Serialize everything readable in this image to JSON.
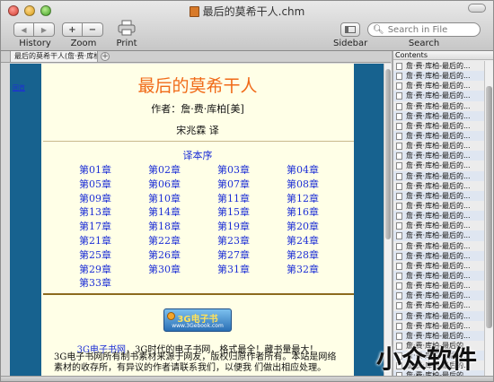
{
  "window": {
    "title": "最后的莫希干人.chm"
  },
  "toolbar": {
    "history_label": "History",
    "zoom_label": "Zoom",
    "print_label": "Print",
    "sidebar_label": "Sidebar",
    "search_label": "Search",
    "back_glyph": "◀",
    "forward_glyph": "▶",
    "zoom_in_glyph": "+",
    "zoom_out_glyph": "−",
    "search_placeholder": "Search in File",
    "search_icon_glyph": "🔍︎"
  },
  "tabs": [
    {
      "label": "最后的莫希干人(詹·费·库柏)"
    }
  ],
  "tab_add_glyph": "+",
  "page": {
    "left_nav_link": "回首",
    "title": "最后的莫希干人",
    "author": "作者：詹·费·库柏[美]",
    "translator": "宋兆霖  译",
    "preface": "译本序",
    "chapters": [
      "第01章",
      "第02章",
      "第03章",
      "第04章",
      "第05章",
      "第06章",
      "第07章",
      "第08章",
      "第09章",
      "第10章",
      "第11章",
      "第12章",
      "第13章",
      "第14章",
      "第15章",
      "第16章",
      "第17章",
      "第18章",
      "第19章",
      "第20章",
      "第21章",
      "第22章",
      "第23章",
      "第24章",
      "第25章",
      "第26章",
      "第27章",
      "第28章",
      "第29章",
      "第30章",
      "第31章",
      "第32章",
      "第33章"
    ],
    "logo_main": "3G电子书",
    "logo_sub": "www.3Gebook.com",
    "footer_link": "3G电子书网",
    "footer_line1_rest": "，3G时代的电子书网，格式最全！藏书量最大！",
    "footer_line2": "3G电子书网所有制书素材来源于网友，版权归原作者所有。本站是网络",
    "footer_line3": "素材的收存所，有异议的作者请联系我们，以便我 们做出相应处理。"
  },
  "sidebar": {
    "header": "Contents",
    "items": [
      "詹·费·库柏-最后的...",
      "詹·费·库柏-最后的...",
      "詹·费·库柏-最后的...",
      "詹·费·库柏-最后的...",
      "詹·费·库柏-最后的...",
      "詹·费·库柏-最后的...",
      "詹·费·库柏-最后的...",
      "詹·费·库柏-最后的...",
      "詹·费·库柏-最后的...",
      "詹·费·库柏-最后的...",
      "詹·费·库柏-最后的...",
      "詹·费·库柏-最后的...",
      "詹·费·库柏-最后的...",
      "詹·费·库柏-最后的...",
      "詹·费·库柏-最后的...",
      "詹·费·库柏-最后的...",
      "詹·费·库柏-最后的...",
      "詹·费·库柏-最后的...",
      "詹·费·库柏-最后的...",
      "詹·费·库柏-最后的...",
      "詹·费·库柏-最后的...",
      "詹·费·库柏-最后的...",
      "詹·费·库柏-最后的...",
      "詹·费·库柏-最后的...",
      "詹·费·库柏-最后的...",
      "詹·费·库柏-最后的...",
      "詹·费·库柏-最后的...",
      "詹·费·库柏-最后的...",
      "詹·费·库柏-最后的...",
      "詹·费·库柏-最后的...",
      "詹·费·库柏-最后的...",
      "詹·费·库柏-最后的..."
    ]
  },
  "watermark": "小众软件",
  "colors": {
    "title_orange": "#f06a18",
    "link_blue": "#1d2fd6",
    "page_bg": "#ffffe7",
    "frame_blue": "#17628f"
  }
}
